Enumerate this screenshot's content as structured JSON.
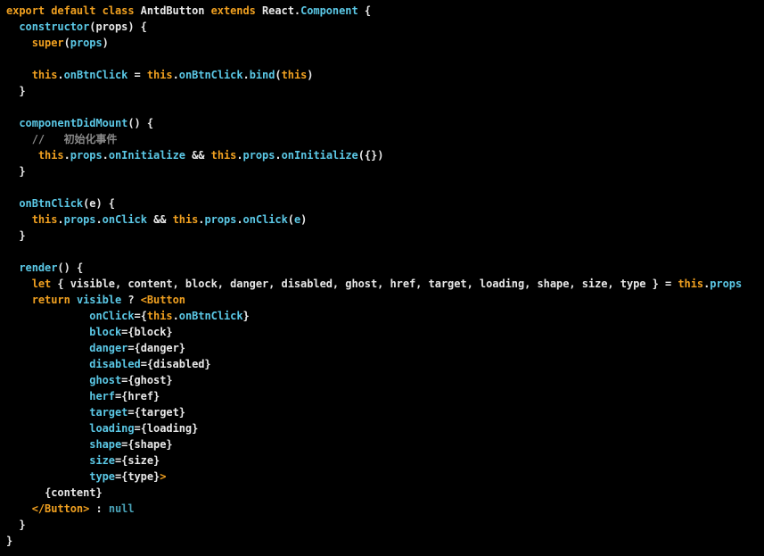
{
  "editor": {
    "language": "javascript-jsx",
    "colors": {
      "background": "#000000",
      "keyword": "#f0a020",
      "function": "#5bc8e6",
      "property": "#5bc8e6",
      "plain": "#e8e8e8",
      "comment": "#8a8a8a",
      "this": "#f0a020",
      "null": "#4aa3b8"
    },
    "lines": [
      [
        [
          "export default class ",
          "keyword"
        ],
        [
          "AntdButton ",
          "plain"
        ],
        [
          "extends ",
          "keyword"
        ],
        [
          "React",
          "plain"
        ],
        [
          ".",
          "plain"
        ],
        [
          "Component",
          "function"
        ],
        [
          " {",
          "plain"
        ]
      ],
      [
        [
          "  ",
          "plain"
        ],
        [
          "constructor",
          "function"
        ],
        [
          "(props) {",
          "plain"
        ]
      ],
      [
        [
          "    ",
          "plain"
        ],
        [
          "super",
          "keyword"
        ],
        [
          "(",
          "plain"
        ],
        [
          "props",
          "property"
        ],
        [
          ")",
          "plain"
        ]
      ],
      [
        [
          "",
          "plain"
        ]
      ],
      [
        [
          "    ",
          "plain"
        ],
        [
          "this",
          "this"
        ],
        [
          ".",
          "plain"
        ],
        [
          "onBtnClick",
          "property"
        ],
        [
          " = ",
          "plain"
        ],
        [
          "this",
          "this"
        ],
        [
          ".",
          "plain"
        ],
        [
          "onBtnClick",
          "property"
        ],
        [
          ".",
          "plain"
        ],
        [
          "bind",
          "function"
        ],
        [
          "(",
          "plain"
        ],
        [
          "this",
          "this"
        ],
        [
          ")",
          "plain"
        ]
      ],
      [
        [
          "  }",
          "plain"
        ]
      ],
      [
        [
          "",
          "plain"
        ]
      ],
      [
        [
          "  ",
          "plain"
        ],
        [
          "componentDidMount",
          "function"
        ],
        [
          "() {",
          "plain"
        ]
      ],
      [
        [
          "    ",
          "plain"
        ],
        [
          "//   初始化事件",
          "comment"
        ]
      ],
      [
        [
          "     ",
          "plain"
        ],
        [
          "this",
          "this"
        ],
        [
          ".",
          "plain"
        ],
        [
          "props",
          "property"
        ],
        [
          ".",
          "plain"
        ],
        [
          "onInitialize",
          "property"
        ],
        [
          " && ",
          "plain"
        ],
        [
          "this",
          "this"
        ],
        [
          ".",
          "plain"
        ],
        [
          "props",
          "property"
        ],
        [
          ".",
          "plain"
        ],
        [
          "onInitialize",
          "property"
        ],
        [
          "({})",
          "plain"
        ]
      ],
      [
        [
          "  }",
          "plain"
        ]
      ],
      [
        [
          "",
          "plain"
        ]
      ],
      [
        [
          "  ",
          "plain"
        ],
        [
          "onBtnClick",
          "function"
        ],
        [
          "(e) {",
          "plain"
        ]
      ],
      [
        [
          "    ",
          "plain"
        ],
        [
          "this",
          "this"
        ],
        [
          ".",
          "plain"
        ],
        [
          "props",
          "property"
        ],
        [
          ".",
          "plain"
        ],
        [
          "onClick",
          "property"
        ],
        [
          " && ",
          "plain"
        ],
        [
          "this",
          "this"
        ],
        [
          ".",
          "plain"
        ],
        [
          "props",
          "property"
        ],
        [
          ".",
          "plain"
        ],
        [
          "onClick",
          "property"
        ],
        [
          "(",
          "plain"
        ],
        [
          "e",
          "property"
        ],
        [
          ")",
          "plain"
        ]
      ],
      [
        [
          "  }",
          "plain"
        ]
      ],
      [
        [
          "",
          "plain"
        ]
      ],
      [
        [
          "  ",
          "plain"
        ],
        [
          "render",
          "function"
        ],
        [
          "() {",
          "plain"
        ]
      ],
      [
        [
          "    ",
          "plain"
        ],
        [
          "let ",
          "keyword"
        ],
        [
          "{ visible, content, block, danger, disabled, ghost, href, target, loading, shape, size, type } = ",
          "plain"
        ],
        [
          "this",
          "this"
        ],
        [
          ".",
          "plain"
        ],
        [
          "props",
          "property"
        ]
      ],
      [
        [
          "    ",
          "plain"
        ],
        [
          "return ",
          "keyword"
        ],
        [
          "visible",
          "property"
        ],
        [
          " ? ",
          "plain"
        ],
        [
          "<Button",
          "keyword"
        ]
      ],
      [
        [
          "             ",
          "plain"
        ],
        [
          "onClick",
          "property"
        ],
        [
          "={",
          "plain"
        ],
        [
          "this",
          "this"
        ],
        [
          ".",
          "plain"
        ],
        [
          "onBtnClick",
          "property"
        ],
        [
          "}",
          "plain"
        ]
      ],
      [
        [
          "             ",
          "plain"
        ],
        [
          "block",
          "property"
        ],
        [
          "={block}",
          "plain"
        ]
      ],
      [
        [
          "             ",
          "plain"
        ],
        [
          "danger",
          "property"
        ],
        [
          "={danger}",
          "plain"
        ]
      ],
      [
        [
          "             ",
          "plain"
        ],
        [
          "disabled",
          "property"
        ],
        [
          "={disabled}",
          "plain"
        ]
      ],
      [
        [
          "             ",
          "plain"
        ],
        [
          "ghost",
          "property"
        ],
        [
          "={ghost}",
          "plain"
        ]
      ],
      [
        [
          "             ",
          "plain"
        ],
        [
          "herf",
          "property"
        ],
        [
          "={href}",
          "plain"
        ]
      ],
      [
        [
          "             ",
          "plain"
        ],
        [
          "target",
          "property"
        ],
        [
          "={target}",
          "plain"
        ]
      ],
      [
        [
          "             ",
          "plain"
        ],
        [
          "loading",
          "property"
        ],
        [
          "={loading}",
          "plain"
        ]
      ],
      [
        [
          "             ",
          "plain"
        ],
        [
          "shape",
          "property"
        ],
        [
          "={shape}",
          "plain"
        ]
      ],
      [
        [
          "             ",
          "plain"
        ],
        [
          "size",
          "property"
        ],
        [
          "={size}",
          "plain"
        ]
      ],
      [
        [
          "             ",
          "plain"
        ],
        [
          "type",
          "property"
        ],
        [
          "={type}",
          "plain"
        ],
        [
          ">",
          "keyword"
        ]
      ],
      [
        [
          "      ",
          "plain"
        ],
        [
          "{content}",
          "plain"
        ]
      ],
      [
        [
          "    ",
          "plain"
        ],
        [
          "</Button>",
          "keyword"
        ],
        [
          " : ",
          "plain"
        ],
        [
          "null",
          "null"
        ]
      ],
      [
        [
          "  }",
          "plain"
        ]
      ],
      [
        [
          "}",
          "plain"
        ]
      ]
    ]
  }
}
